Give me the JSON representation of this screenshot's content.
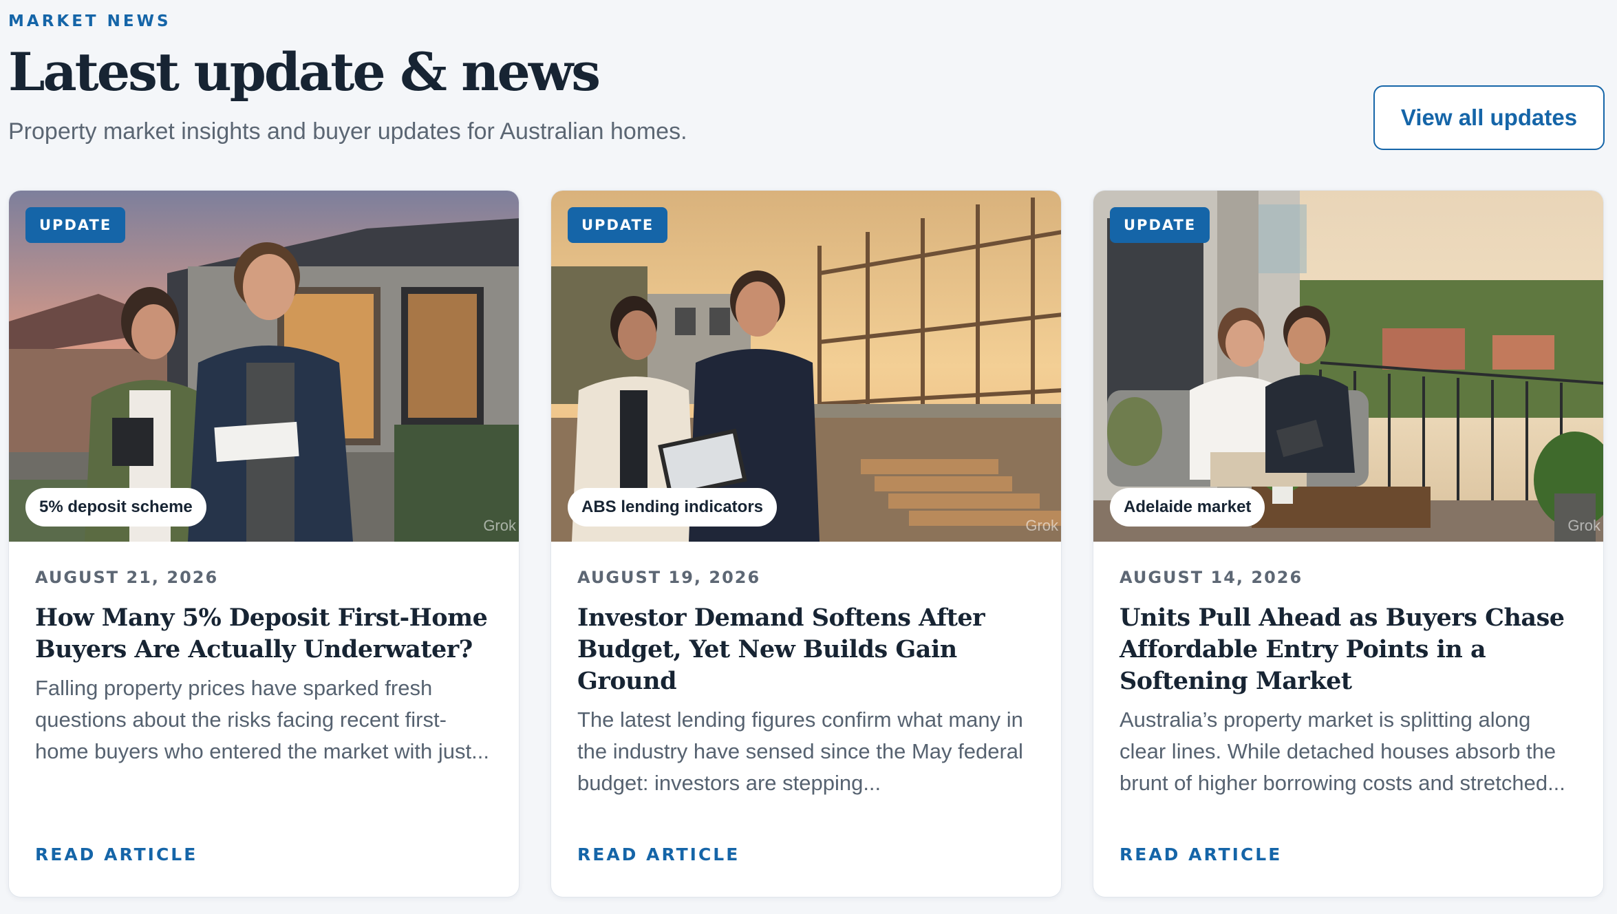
{
  "header": {
    "eyebrow": "MARKET NEWS",
    "title": "Latest update & news",
    "subtitle": "Property market insights and buyer updates for Australian homes.",
    "view_all_label": "View all updates"
  },
  "colors": {
    "accent": "#1565a8",
    "heading": "#172433",
    "body_text": "#566270",
    "background": "#f4f6f9"
  },
  "cards": [
    {
      "badge": "UPDATE",
      "tag": "5% deposit scheme",
      "watermark": "Grok",
      "date": "AUGUST 21, 2026",
      "headline": "How Many 5% Deposit First-Home Buyers Are Actually Underwater?",
      "excerpt": "Falling property prices have sparked fresh questions about the risks facing recent first-home buyers who entered the market with just...",
      "cta": "READ ARTICLE",
      "image_subject": "young couple in front of new house at dusk"
    },
    {
      "badge": "UPDATE",
      "tag": "ABS lending indicators",
      "watermark": "Grok",
      "date": "AUGUST 19, 2026",
      "headline": "Investor Demand Softens After Budget, Yet New Builds Gain Ground",
      "excerpt": "The latest lending figures confirm what many in the industry have sensed since the May federal budget: investors are stepping...",
      "cta": "READ ARTICLE",
      "image_subject": "couple reviewing plans on tablet at construction site"
    },
    {
      "badge": "UPDATE",
      "tag": "Adelaide market",
      "watermark": "Grok",
      "date": "AUGUST 14, 2026",
      "headline": "Units Pull Ahead as Buyers Chase Affordable Entry Points in a Softening Market",
      "excerpt": "Australia’s property market is splitting along clear lines. While detached houses absorb the brunt of higher borrowing costs and stretched...",
      "cta": "READ ARTICLE",
      "image_subject": "couple on apartment balcony looking at tablet"
    }
  ]
}
